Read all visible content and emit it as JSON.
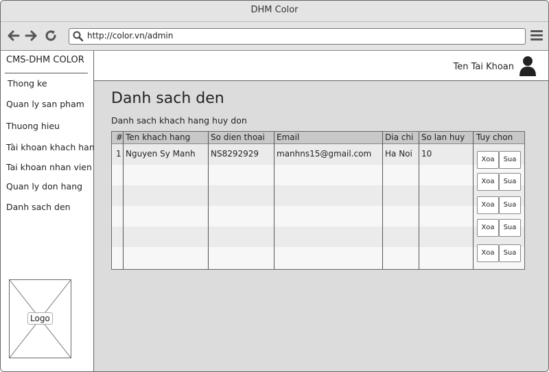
{
  "window": {
    "title": "DHM Color"
  },
  "browser": {
    "url": "http://color.vn/admin"
  },
  "sidebar": {
    "brand": "CMS-DHM COLOR",
    "items": [
      {
        "label": "Thong ke"
      },
      {
        "label": "Quan ly san pham"
      },
      {
        "label": "Thuong hieu"
      },
      {
        "label": "Tài khoan khach hang"
      },
      {
        "label": "Tai khoan nhan vien"
      },
      {
        "label": "Quan ly don hang"
      },
      {
        "label": "Danh sach den"
      }
    ],
    "logo_label": "Logo"
  },
  "header": {
    "account_name": "Ten Tai Khoan",
    "user_icon": "user-icon"
  },
  "main": {
    "title": "Danh sach den",
    "subtitle": "Danh sach khach hang huy don",
    "table": {
      "columns": [
        "#",
        "Ten khach hang",
        "So dien thoai",
        "Email",
        "Dia chi",
        "So lan huy",
        "Tuy chon"
      ],
      "rows": [
        {
          "no": "1",
          "name": "Nguyen Sy Manh",
          "phone": "NS8292929",
          "email": "manhns15@gmail.com",
          "address": "Ha Noi",
          "cancel_count": "10"
        }
      ],
      "actions": {
        "delete_label": "Xoa",
        "edit_label": "Sua"
      }
    }
  },
  "colors": {
    "content_bg": "#dcdcdc",
    "header_row": "#c8c8c8",
    "stripe": "#ebebeb"
  }
}
